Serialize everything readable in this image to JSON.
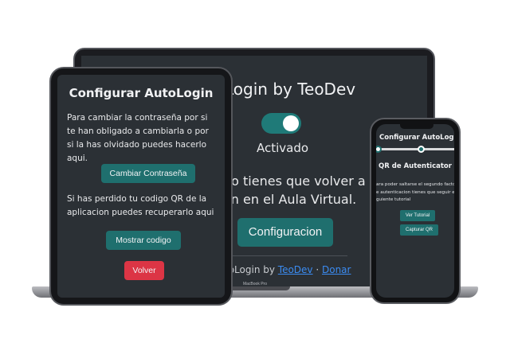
{
  "laptop": {
    "title": "Login by TeoDev",
    "status": "Activado",
    "line1": "no tienes que volver a inic",
    "line2": "ón en el Aula Virtual.",
    "config_label": "Configuracion",
    "footer_prefix": "toLogin by ",
    "footer_link1": "TeoDev",
    "footer_sep": " · ",
    "footer_link2": "Donar",
    "brand": "MacBook Pro"
  },
  "tablet": {
    "title": "Configurar AutoLogin",
    "paragraph1": "Para cambiar la contraseña por si te han obligado a cambiarla o por si la has olvidado puedes hacerlo aqui.",
    "change_password_label": "Cambiar Contraseña",
    "paragraph2": "Si has perdido tu codigo QR de la aplicacion puedes recuperarlo aqui",
    "show_code_label": "Mostrar codigo",
    "back_label": "Volver"
  },
  "phone": {
    "title": "Configurar AutoLogin",
    "subtitle": "QR de Autenticator",
    "line1": "ara poder saltarse el segundo facto",
    "line2": "e autenticacion tienes que seguir e",
    "line3": "guiente tutorial",
    "tutorial_label": "Ver Tutorial",
    "capture_label": "Capturar QR"
  },
  "colors": {
    "accent": "#1f6f6e",
    "danger": "#dc3545",
    "screen_bg": "#2b3035",
    "link": "#3b8cf2"
  }
}
